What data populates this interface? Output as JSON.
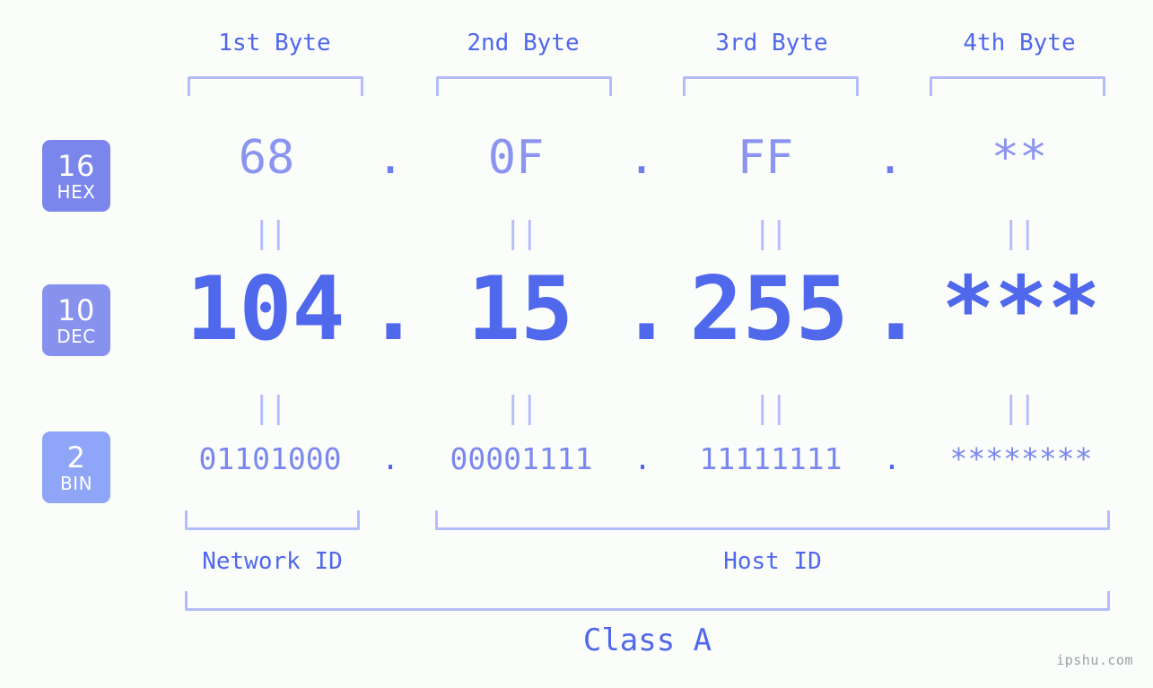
{
  "headers": [
    {
      "label": "1st Byte"
    },
    {
      "label": "2nd Byte"
    },
    {
      "label": "3rd Byte"
    },
    {
      "label": "4th Byte"
    }
  ],
  "bases": [
    {
      "num": "16",
      "abbr": "HEX",
      "color": "#7b86ec"
    },
    {
      "num": "10",
      "abbr": "DEC",
      "color": "#8792ef"
    },
    {
      "num": "2",
      "abbr": "BIN",
      "color": "#8fa5f8"
    }
  ],
  "rows": {
    "hex": {
      "base_num": "16",
      "base_abbr": "HEX",
      "values": [
        "68",
        "0F",
        "FF",
        "**"
      ],
      "separator": "."
    },
    "dec": {
      "base_num": "10",
      "base_abbr": "DEC",
      "values": [
        "104",
        "15",
        "255",
        "***"
      ],
      "separator": "."
    },
    "bin": {
      "base_num": "2",
      "base_abbr": "BIN",
      "values": [
        "01101000",
        "00001111",
        "11111111",
        "********"
      ],
      "separator": "."
    }
  },
  "equals_mark": "||",
  "regions": [
    {
      "label": "Network ID"
    },
    {
      "label": "Host ID"
    }
  ],
  "class": {
    "label": "Class A"
  },
  "watermark": {
    "text": "ipshu.com"
  },
  "colors": {
    "background": "#fbfdfa",
    "accent_strong": "#4f68ec",
    "accent_mid": "#7a87ef",
    "accent_light": "#8b95f0",
    "bracket": "#b4bdfb",
    "badge_hex": "#7b86ec",
    "badge_dec": "#8792ef",
    "badge_bin": "#8fa5f8",
    "watermark": "#9aa0a6"
  }
}
